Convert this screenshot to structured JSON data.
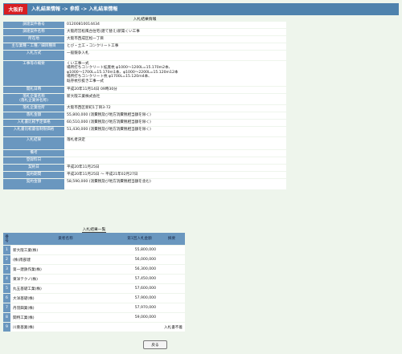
{
  "header": {
    "prefecture": "大阪府",
    "title": "入札結果情報 -> 参照 -> 入札結果情報"
  },
  "detail": {
    "section_title": "入札結果情報",
    "rows": [
      {
        "label": "調達案件番号",
        "value": "01200810014434"
      },
      {
        "label": "調達案件名称",
        "value": "大阪府営松風台住宅(建て替え)新築くい工事"
      },
      {
        "label": "所在地",
        "value": "大阪市西成区松一丁目"
      },
      {
        "label": "主な業種・工種／細目種目",
        "value": "とび・土工・コンクリート工事"
      },
      {
        "label": "入札方式",
        "value": "一般競争入札"
      },
      {
        "label": "工事等の概要",
        "value": "くい工事一式\n場所打ちコンクリート拡底杭 φ1000〜1200L=15.170m2本、\nφ1000〜1700L=15.170m1本、φ1000〜2200L=15.120m12本\n場所打ちコンクリート杭 φ1700L=15.120m4本、\n既存杭引抜き工事一式"
      },
      {
        "label": "開札日時",
        "value": "平成20年11月14日 09時30分"
      },
      {
        "label": "落札企業名称\n(落札企業体名称)",
        "value": "新大阪工業株式会社"
      },
      {
        "label": "落札企業住所",
        "value": "大阪市西区新町1丁目3-72"
      },
      {
        "label": "落札金額",
        "value": "55,800,000 (消費税及び地方消費税相当額を除く)"
      },
      {
        "label": "入札書比較予定価格",
        "value": "60,510,000 (消費税及び地方消費税相当額を除く)"
      },
      {
        "label": "入札書比較最低制限価格",
        "value": "51,430,000 (消費税及び地方消費税相当額を除く)"
      },
      {
        "label": "入札結果",
        "value": "落札者決定"
      },
      {
        "label": "備考",
        "value": ""
      },
      {
        "label": "登録料日",
        "value": ""
      },
      {
        "label": "契約日",
        "value": "平成20年11月25日"
      },
      {
        "label": "契約期間",
        "value": "平成20年11月25日 〜 平成21年02月27日"
      },
      {
        "label": "契約金額",
        "value": "58,590,000 (消費税及び地方消費税相当額を含む)"
      }
    ]
  },
  "bids": {
    "section_title": "入札結果一覧",
    "columns": [
      "番号",
      "業者名称",
      "第1回入札金額",
      "摘要"
    ],
    "rows": [
      {
        "no": "1",
        "name": "新大阪工業(株)",
        "amount": "55,800,000",
        "note": ""
      },
      {
        "no": "2",
        "name": "(株)南部建",
        "amount": "56,000,000",
        "note": ""
      },
      {
        "no": "3",
        "name": "第一建鉄作業(株)",
        "amount": "56,300,000",
        "note": ""
      },
      {
        "no": "4",
        "name": "東洋テクノ(株)",
        "amount": "57,450,000",
        "note": ""
      },
      {
        "no": "5",
        "name": "丸五基礎工業(株)",
        "amount": "57,600,000",
        "note": ""
      },
      {
        "no": "6",
        "name": "大洋基礎(株)",
        "amount": "57,900,000",
        "note": ""
      },
      {
        "no": "7",
        "name": "丹羽興業(株)",
        "amount": "57,970,000",
        "note": ""
      },
      {
        "no": "8",
        "name": "関特工業(株)",
        "amount": "59,000,000",
        "note": ""
      },
      {
        "no": "9",
        "name": "川重基業(株)",
        "amount": "",
        "note": "入札書不着"
      }
    ]
  },
  "back_button_label": "戻る",
  "colors": {
    "page_background": "#eef5ec",
    "header_bar": "#4e82ad",
    "prefecture_badge": "#d81e22",
    "label_cell": "#6a97bf"
  }
}
